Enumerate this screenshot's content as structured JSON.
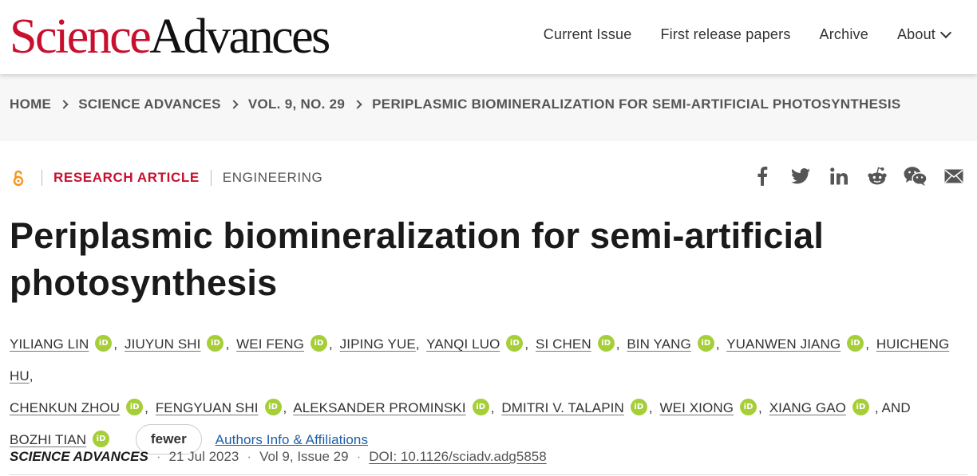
{
  "site": {
    "logo_part1": "Science",
    "logo_part2": "Advances"
  },
  "nav": {
    "items": [
      {
        "label": "Current Issue"
      },
      {
        "label": "First release papers"
      },
      {
        "label": "Archive"
      },
      {
        "label": "About"
      }
    ]
  },
  "breadcrumb": {
    "items": [
      "HOME",
      "SCIENCE ADVANCES",
      "VOL. 9, NO. 29"
    ],
    "current": "PERIPLASMIC BIOMINERALIZATION FOR SEMI-ARTIFICIAL PHOTOSYNTHESIS"
  },
  "article": {
    "type": "RESEARCH ARTICLE",
    "subject": "ENGINEERING",
    "title": "Periplasmic biomineralization for semi-artificial photosynthesis",
    "authors": [
      "YILIANG LIN",
      "JIUYUN SHI",
      "WEI FENG",
      "JIPING YUE",
      "YANQI LUO",
      "SI CHEN",
      "BIN YANG",
      "YUANWEN JIANG",
      "HUICHENG HU",
      "CHENKUN ZHOU",
      "FENGYUAN SHI",
      "ALEKSANDER PROMINSKI",
      "DMITRI V. TALAPIN",
      "WEI XIONG",
      "XIANG GAO",
      "BOZHI TIAN"
    ],
    "and_label": ", AND",
    "orcid_label": "iD",
    "fewer_label": "fewer",
    "affiliations_label": "Authors Info & Affiliations",
    "journal": "SCIENCE ADVANCES",
    "date": "21 Jul 2023",
    "volume": "Vol 9, Issue 29",
    "doi": "DOI: 10.1126/sciadv.adg5858"
  },
  "share": {
    "icons": [
      "facebook-icon",
      "twitter-icon",
      "linkedin-icon",
      "reddit-icon",
      "wechat-icon",
      "email-icon"
    ]
  },
  "colors": {
    "brand_red": "#c8102e",
    "orcid_green": "#a6ce39",
    "link_blue": "#1d5fa8",
    "oa_orange": "#f7931e"
  }
}
